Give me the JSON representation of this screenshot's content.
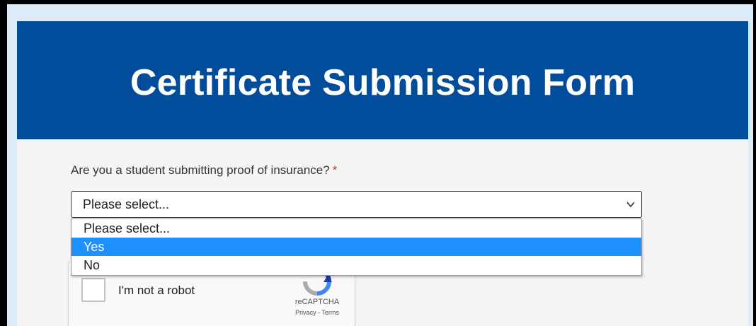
{
  "header": {
    "title": "Certificate Submission Form"
  },
  "form": {
    "question": "Are you a student submitting proof of insurance?",
    "required_mark": "*",
    "select": {
      "value": "Please select...",
      "options": [
        "Please select...",
        "Yes",
        "No"
      ],
      "highlighted": "Yes"
    }
  },
  "captcha": {
    "label": "I'm not a robot",
    "brand": "reCAPTCHA",
    "privacy": "Privacy",
    "separator": " - ",
    "terms": "Terms"
  },
  "colors": {
    "header_bg": "#014c9b",
    "highlight": "#1e90ff",
    "required": "#c0392b",
    "page_bg": "#dcebf8"
  },
  "icons": [
    "chevron-down-icon",
    "recaptcha-logo-icon"
  ]
}
